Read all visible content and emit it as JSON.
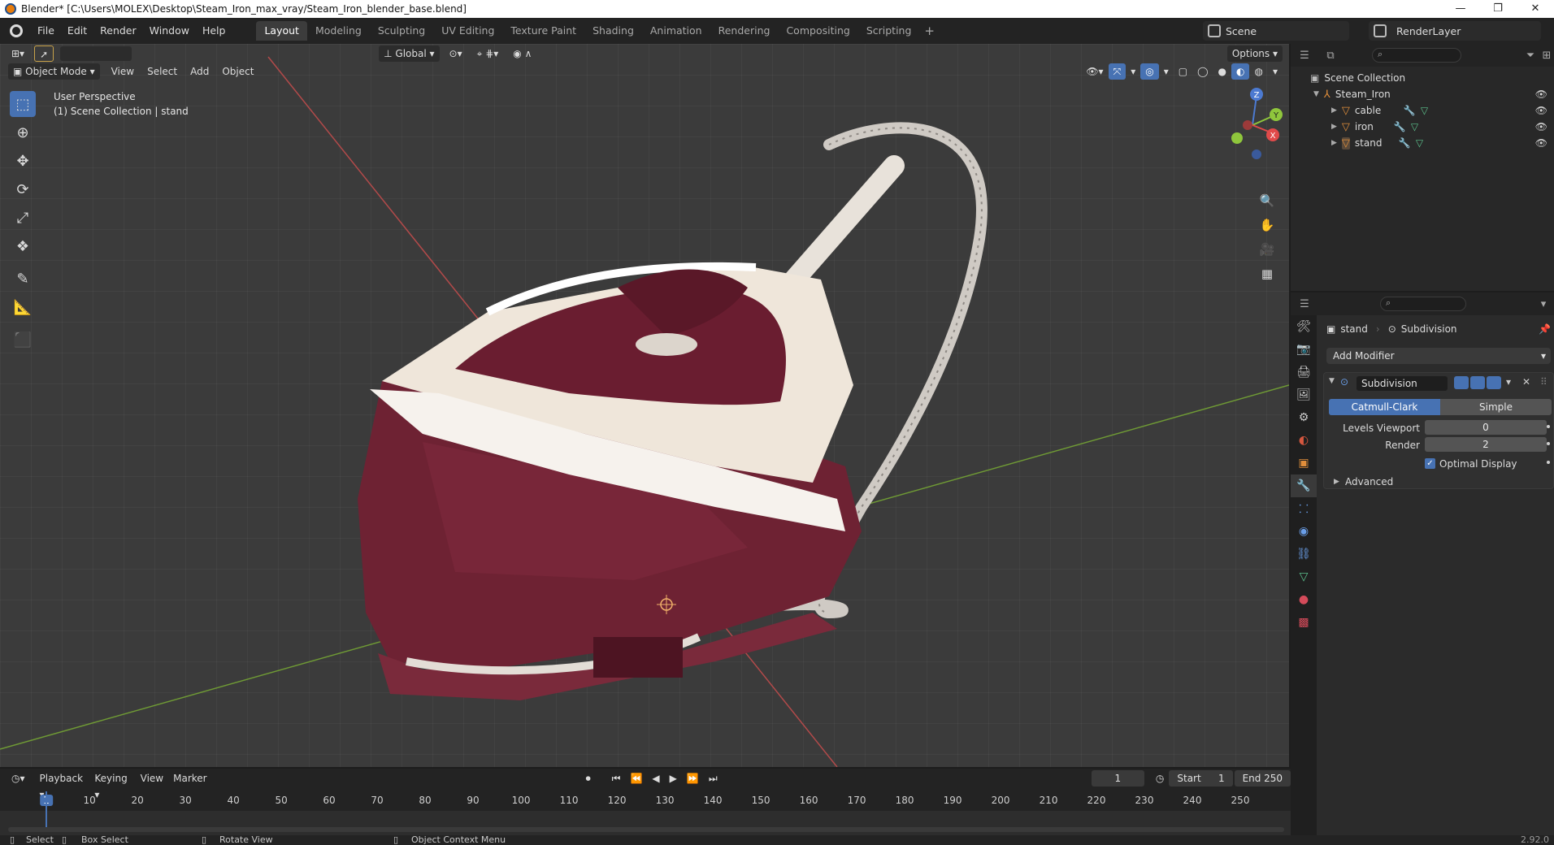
{
  "window": {
    "title": "Blender* [C:\\Users\\MOLEX\\Desktop\\Steam_Iron_max_vray/Steam_Iron_blender_base.blend]",
    "controls": [
      "—",
      "❐",
      "✕"
    ]
  },
  "menu": [
    "File",
    "Edit",
    "Render",
    "Window",
    "Help"
  ],
  "workspaces": [
    "Layout",
    "Modeling",
    "Sculpting",
    "UV Editing",
    "Texture Paint",
    "Shading",
    "Animation",
    "Rendering",
    "Compositing",
    "Scripting"
  ],
  "active_workspace": "Layout",
  "scene": "Scene",
  "render_layer": "RenderLayer",
  "viewport": {
    "mode": "Object Mode",
    "menus": [
      "View",
      "Select",
      "Add",
      "Object"
    ],
    "orientation": "Global",
    "options_label": "Options",
    "info_line1": "User Perspective",
    "info_line2": "(1) Scene Collection | stand",
    "gizmo_axes": [
      "X",
      "Y",
      "Z"
    ]
  },
  "outliner": {
    "root": "Scene Collection",
    "collection": "Steam_Iron",
    "objects": [
      "cable",
      "iron",
      "stand"
    ]
  },
  "properties": {
    "object": "stand",
    "modifier_crumb": "Subdivision",
    "add_modifier": "Add Modifier",
    "modifier_name": "Subdivision",
    "algo_options": [
      "Catmull-Clark",
      "Simple"
    ],
    "algo_selected": "Catmull-Clark",
    "levels_viewport_label": "Levels Viewport",
    "levels_viewport": "0",
    "render_label": "Render",
    "render_levels": "2",
    "optimal_display_label": "Optimal Display",
    "optimal_display": true,
    "advanced_label": "Advanced"
  },
  "timeline": {
    "menus": [
      "Playback",
      "Keying",
      "View",
      "Marker"
    ],
    "current_frame": "1",
    "start_label": "Start",
    "start": "1",
    "end_label": "End",
    "end": "250",
    "ticks": [
      "1",
      "10",
      "20",
      "30",
      "40",
      "50",
      "60",
      "70",
      "80",
      "90",
      "100",
      "110",
      "120",
      "130",
      "140",
      "150",
      "160",
      "170",
      "180",
      "190",
      "200",
      "210",
      "220",
      "230",
      "240",
      "250"
    ]
  },
  "statusbar": {
    "select": "Select",
    "box_select": "Box Select",
    "rotate_view": "Rotate View",
    "context_menu": "Object Context Menu",
    "version": "2.92.0"
  },
  "colors": {
    "accent": "#4772b3",
    "iron_body": "#6e2233",
    "x_axis": "#c84646",
    "y_axis": "#7fae3a"
  }
}
